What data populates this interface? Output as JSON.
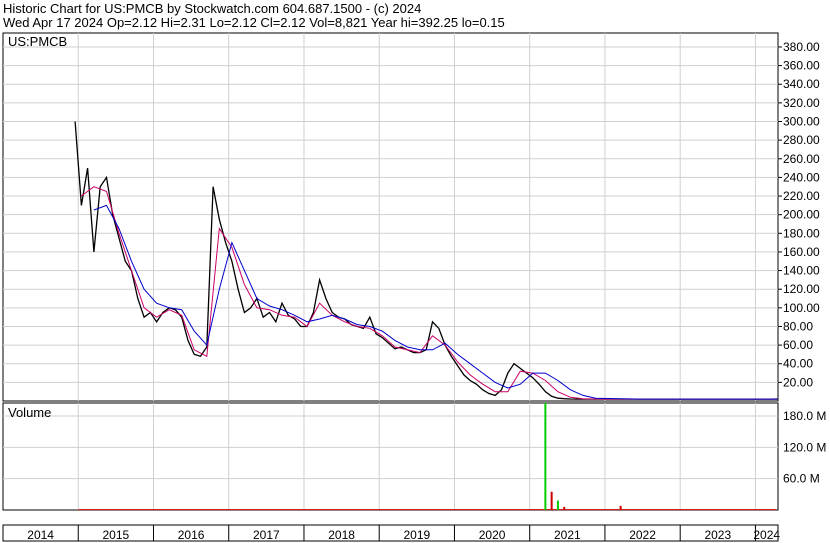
{
  "header": {
    "line1": "Historic Chart for US:PMCB by Stockwatch.com 604.687.1500 - (c) 2024",
    "line2": "Wed Apr 17 2024  Op=2.12  Hi=2.31  Lo=2.12  Cl=2.12  Vol=8,821  Year hi=392.25  lo=0.15"
  },
  "chart_data": [
    {
      "type": "line",
      "label": "US:PMCB",
      "ylim": [
        0,
        395
      ],
      "y_ticks": [
        "20.00",
        "40.00",
        "60.00",
        "80.00",
        "100.00",
        "120.00",
        "140.00",
        "160.00",
        "180.00",
        "200.00",
        "220.00",
        "240.00",
        "260.00",
        "280.00",
        "300.00",
        "320.00",
        "340.00",
        "360.00",
        "380.00"
      ],
      "x_ticks": [
        "2014",
        "2015",
        "2016",
        "2017",
        "2018",
        "2019",
        "2020",
        "2021",
        "2022",
        "2023",
        "2024"
      ],
      "grid": true,
      "series": [
        {
          "color": "#000000",
          "x": [
            "2014-12",
            "2015-01",
            "2015-02",
            "2015-03",
            "2015-04",
            "2015-05",
            "2015-06",
            "2015-07",
            "2015-08",
            "2015-09",
            "2015-10",
            "2015-11",
            "2015-12",
            "2016-01",
            "2016-02",
            "2016-03",
            "2016-04",
            "2016-05",
            "2016-06",
            "2016-07",
            "2016-08",
            "2016-09",
            "2016-10",
            "2016-11",
            "2016-12",
            "2017-01",
            "2017-02",
            "2017-03",
            "2017-04",
            "2017-05",
            "2017-06",
            "2017-07",
            "2017-08",
            "2017-09",
            "2017-10",
            "2017-11",
            "2017-12",
            "2018-01",
            "2018-02",
            "2018-03",
            "2018-04",
            "2018-05",
            "2018-06",
            "2018-07",
            "2018-08",
            "2018-09",
            "2018-10",
            "2018-11",
            "2018-12",
            "2019-01",
            "2019-02",
            "2019-03",
            "2019-04",
            "2019-05",
            "2019-06",
            "2019-07",
            "2019-08",
            "2019-09",
            "2019-10",
            "2019-11",
            "2019-12",
            "2020-01",
            "2020-02",
            "2020-03",
            "2020-04",
            "2020-05",
            "2020-06",
            "2020-07",
            "2020-08",
            "2020-09",
            "2020-10",
            "2020-11",
            "2020-12",
            "2021-01",
            "2021-02",
            "2021-03",
            "2021-04",
            "2021-05",
            "2021-06",
            "2021-07",
            "2021-08",
            "2021-09",
            "2021-10",
            "2021-12",
            "2022-03",
            "2022-06",
            "2022-09",
            "2022-12",
            "2023-03",
            "2023-06",
            "2023-09",
            "2023-12",
            "2024-03",
            "2024-04"
          ],
          "values": [
            300,
            210,
            250,
            160,
            230,
            240,
            200,
            175,
            150,
            140,
            110,
            90,
            95,
            85,
            95,
            100,
            98,
            90,
            65,
            50,
            48,
            58,
            230,
            195,
            170,
            150,
            120,
            95,
            100,
            110,
            90,
            95,
            85,
            105,
            92,
            88,
            80,
            80,
            95,
            130,
            110,
            95,
            90,
            88,
            82,
            80,
            78,
            90,
            72,
            68,
            62,
            56,
            58,
            55,
            52,
            52,
            55,
            85,
            78,
            60,
            48,
            38,
            28,
            22,
            18,
            12,
            8,
            6,
            12,
            30,
            40,
            35,
            30,
            25,
            18,
            10,
            5,
            3,
            2.5,
            2.2,
            2,
            2,
            2,
            2,
            2,
            2,
            2,
            2,
            2,
            2,
            2,
            2,
            2,
            2.12
          ]
        },
        {
          "color": "#cc0066",
          "x": [
            "2015-01",
            "2015-03",
            "2015-05",
            "2015-07",
            "2015-09",
            "2015-11",
            "2016-01",
            "2016-03",
            "2016-05",
            "2016-07",
            "2016-09",
            "2016-11",
            "2017-01",
            "2017-03",
            "2017-05",
            "2017-07",
            "2017-09",
            "2017-11",
            "2018-01",
            "2018-03",
            "2018-05",
            "2018-07",
            "2018-09",
            "2018-11",
            "2019-01",
            "2019-03",
            "2019-05",
            "2019-07",
            "2019-09",
            "2019-11",
            "2020-01",
            "2020-03",
            "2020-05",
            "2020-07",
            "2020-09",
            "2020-11",
            "2021-01",
            "2021-03",
            "2021-05",
            "2021-07",
            "2021-09",
            "2021-11",
            "2022-06",
            "2023-06",
            "2024-04"
          ],
          "values": [
            220,
            230,
            225,
            180,
            140,
            100,
            90,
            98,
            92,
            55,
            48,
            185,
            165,
            125,
            100,
            98,
            92,
            90,
            80,
            105,
            92,
            85,
            80,
            78,
            70,
            58,
            55,
            52,
            70,
            60,
            42,
            28,
            18,
            10,
            10,
            32,
            30,
            22,
            10,
            4,
            2.5,
            2.2,
            2,
            2,
            2
          ]
        },
        {
          "color": "#0000cc",
          "x": [
            "2015-03",
            "2015-05",
            "2015-07",
            "2015-09",
            "2015-11",
            "2016-01",
            "2016-03",
            "2016-05",
            "2016-07",
            "2016-09",
            "2016-11",
            "2017-01",
            "2017-03",
            "2017-05",
            "2017-07",
            "2017-09",
            "2017-11",
            "2018-01",
            "2018-03",
            "2018-05",
            "2018-07",
            "2018-09",
            "2018-11",
            "2019-01",
            "2019-03",
            "2019-05",
            "2019-07",
            "2019-09",
            "2019-11",
            "2020-01",
            "2020-03",
            "2020-05",
            "2020-07",
            "2020-09",
            "2020-11",
            "2021-01",
            "2021-03",
            "2021-05",
            "2021-07",
            "2021-09",
            "2021-11",
            "2022-06",
            "2023-06",
            "2024-04"
          ],
          "values": [
            205,
            210,
            185,
            150,
            120,
            105,
            100,
            98,
            75,
            60,
            120,
            170,
            140,
            110,
            102,
            98,
            92,
            85,
            88,
            92,
            88,
            82,
            80,
            75,
            65,
            58,
            55,
            55,
            62,
            50,
            40,
            30,
            20,
            14,
            18,
            30,
            30,
            22,
            12,
            6,
            3,
            2,
            2,
            2
          ]
        }
      ]
    },
    {
      "type": "bar",
      "label": "Volume",
      "ylim": [
        0,
        205
      ],
      "y_ticks": [
        "60.0 M",
        "120.0 M",
        "180.0 M"
      ],
      "x": [
        "2021-03",
        "2021-04",
        "2021-05",
        "2021-06",
        "2022-03"
      ],
      "values": [
        205,
        35,
        18,
        6,
        8
      ],
      "colors": [
        "#00cc00",
        "#cc0000",
        "#00cc00",
        "#cc0000",
        "#cc0000"
      ]
    }
  ]
}
